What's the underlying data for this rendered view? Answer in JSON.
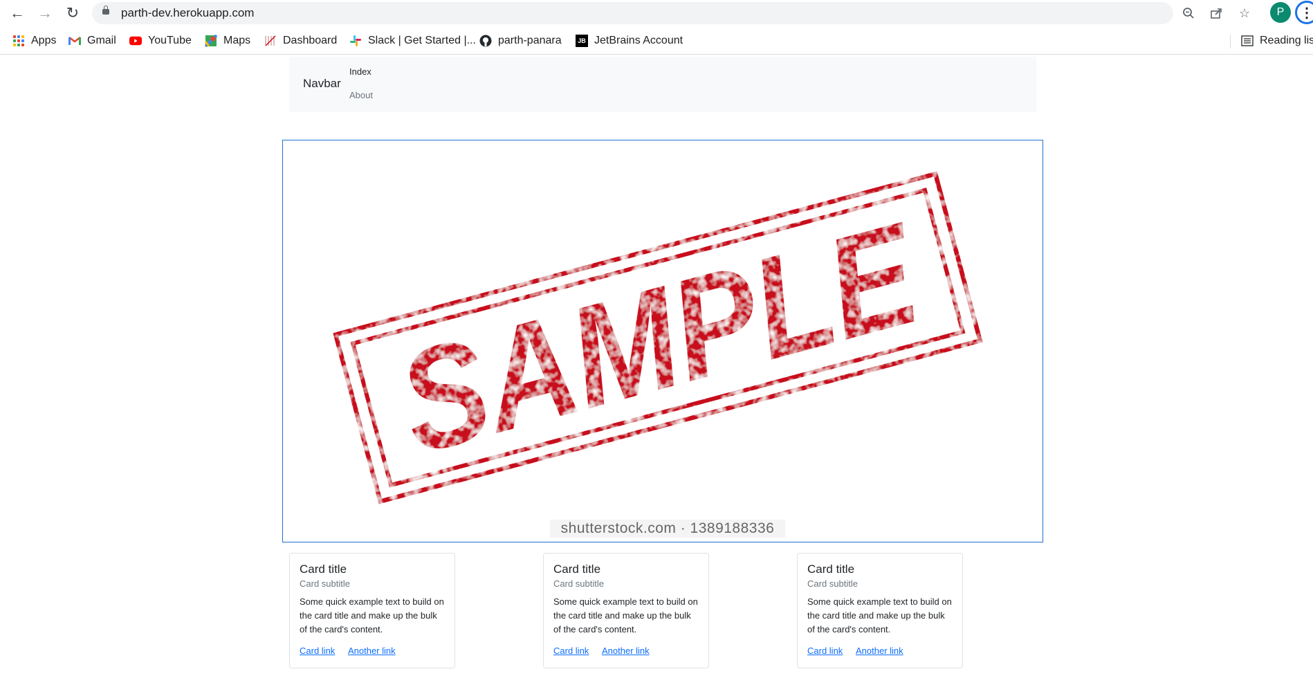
{
  "browser": {
    "url": "parth-dev.herokuapp.com",
    "profile_initial": "P",
    "bookmarks": [
      {
        "label": "Apps",
        "icon": "apps-grid-icon"
      },
      {
        "label": "Gmail",
        "icon": "gmail-icon"
      },
      {
        "label": "YouTube",
        "icon": "youtube-icon"
      },
      {
        "label": "Maps",
        "icon": "maps-icon"
      },
      {
        "label": "Dashboard",
        "icon": "dashboard-icon"
      },
      {
        "label": "Slack | Get Started |...",
        "icon": "slack-icon"
      },
      {
        "label": "parth-panara",
        "icon": "github-icon"
      },
      {
        "label": "JetBrains Account",
        "icon": "jetbrains-icon"
      }
    ],
    "reading_list": "Reading list"
  },
  "navbar": {
    "brand": "Navbar",
    "links": [
      "Index",
      "About"
    ]
  },
  "hero": {
    "stamp_text": "SAMPLE",
    "watermark": "shutterstock.com · 1389188336",
    "stamp_color": "#c8101e"
  },
  "cards": [
    {
      "title": "Card title",
      "subtitle": "Card subtitle",
      "text": "Some quick example text to build on the card title and make up the bulk of the card's content.",
      "link1": "Card link",
      "link2": "Another link"
    },
    {
      "title": "Card title",
      "subtitle": "Card subtitle",
      "text": "Some quick example text to build on the card title and make up the bulk of the card's content.",
      "link1": "Card link",
      "link2": "Another link"
    },
    {
      "title": "Card title",
      "subtitle": "Card subtitle",
      "text": "Some quick example text to build on the card title and make up the bulk of the card's content.",
      "link1": "Card link",
      "link2": "Another link"
    }
  ],
  "colors": {
    "link": "#0d6efd",
    "navbar_bg": "#f8f9fa",
    "hero_border": "#1f6fd1"
  }
}
